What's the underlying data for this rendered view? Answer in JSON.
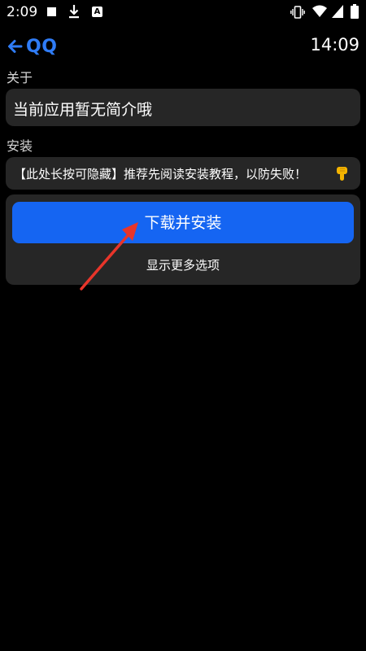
{
  "status_bar": {
    "time": "2:09",
    "app_icon_letter": "A",
    "icons": [
      "stop-icon",
      "download-icon",
      "app-a-icon",
      "vibrate-icon",
      "wifi-icon",
      "signal-icon",
      "battery-icon"
    ]
  },
  "header": {
    "back_icon": "back-arrow-icon",
    "title": "QQ",
    "time": "14:09"
  },
  "about": {
    "label": "关于",
    "text": "当前应用暂无简介哦"
  },
  "install": {
    "label": "安装",
    "notice": "【此处长按可隐藏】推荐先阅读安装教程，以防失败！",
    "notice_icon": "point-down-icon",
    "button_label": "下载并安装",
    "more_options": "显示更多选项"
  },
  "colors": {
    "accent": "#2f7cf6",
    "button": "#1565f2",
    "card": "#262626",
    "annotation": "#e8352a",
    "background": "#000000"
  }
}
